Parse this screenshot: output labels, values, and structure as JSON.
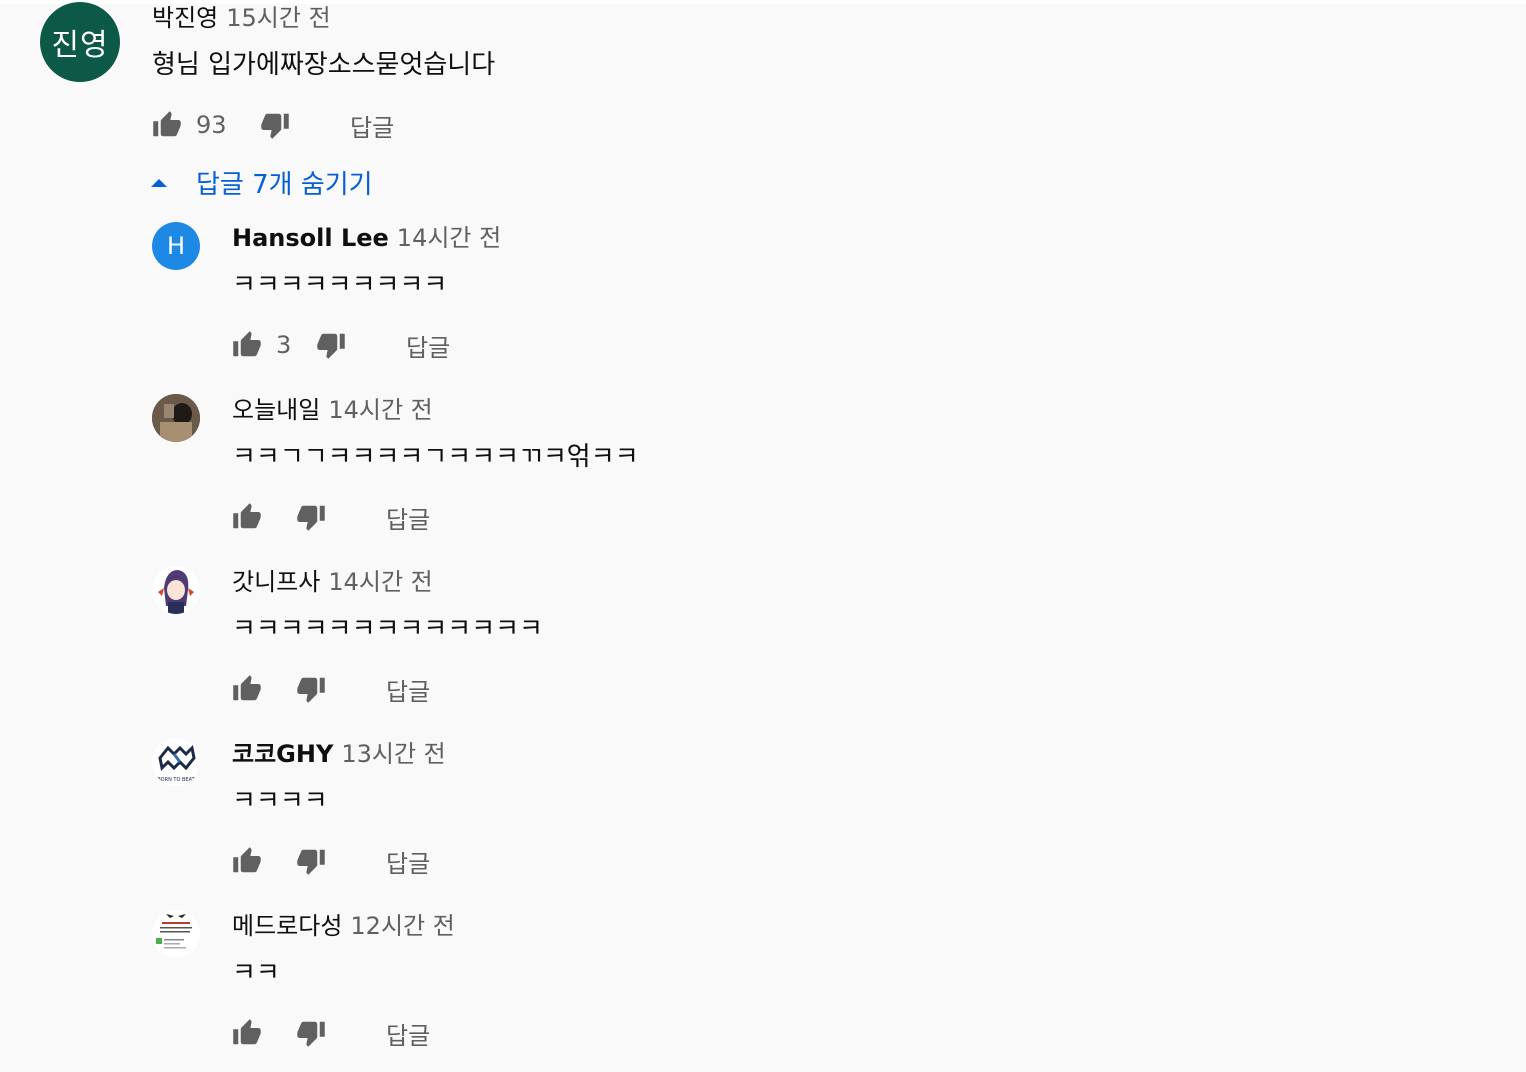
{
  "main_comment": {
    "avatar_text": "진영",
    "author": "박진영",
    "time": "15시간 전",
    "text": "형님  입가에짜장소스묻엇습니다",
    "likes": "93",
    "reply_label": "답글"
  },
  "replies_toggle": {
    "label": "답글 7개 숨기기"
  },
  "replies": [
    {
      "avatar_text": "H",
      "author": "Hansoll Lee",
      "time": "14시간 전",
      "text": "ㅋㅋㅋㅋㅋㅋㅋㅋㅋ",
      "likes": "3",
      "reply_label": "답글"
    },
    {
      "author": "오늘내일",
      "time": "14시간 전",
      "text": "ㅋㅋㄱㄱㅋㅋㅋㅋㄱㅋㅋㅋㄲㅋ얶ㅋㅋ",
      "likes": "",
      "reply_label": "답글"
    },
    {
      "author": "갓니프사",
      "time": "14시간 전",
      "text": "ㅋㅋㅋㅋㅋㅋㅋㅋㅋㅋㅋㅋㅋ",
      "likes": "",
      "reply_label": "답글"
    },
    {
      "author": "코코GHY",
      "time": "13시간 전",
      "text": "ㅋㅋㅋㅋ",
      "likes": "",
      "reply_label": "답글",
      "avatar_logo_text": "BORN TO BEAT"
    },
    {
      "author": "메드로다성",
      "time": "12시간 전",
      "text": "ㅋㅋ",
      "likes": "",
      "reply_label": "답글"
    }
  ],
  "colors": {
    "background": "#f9f9f9",
    "link_blue": "#065fd4",
    "secondary_text": "#606060",
    "main_avatar": "#0b5946",
    "h_avatar": "#1e88e5"
  },
  "icons": {
    "like": "thumb-up-icon",
    "dislike": "thumb-down-icon",
    "collapse": "triangle-up-icon"
  }
}
